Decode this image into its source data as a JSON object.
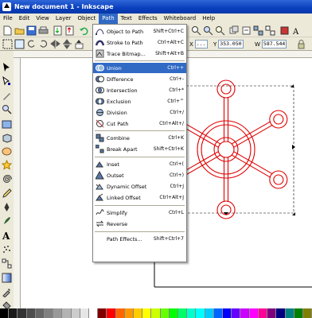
{
  "window": {
    "title": "New document 1 - Inkscape"
  },
  "menubar": [
    "File",
    "Edit",
    "View",
    "Layer",
    "Object",
    "Path",
    "Text",
    "Effects",
    "Whiteboard",
    "Help"
  ],
  "toolbar2": {
    "x_label": "X",
    "x_value": "...",
    "y_label": "Y",
    "y_value": "353.050",
    "w_label": "W",
    "w_value": "587.544"
  },
  "path_menu": [
    {
      "label": "Object to Path",
      "shortcut": "Shift+Ctrl+C",
      "icon": "object-to-path-icon"
    },
    {
      "label": "Stroke to Path",
      "shortcut": "Ctrl+Alt+C",
      "icon": "stroke-to-path-icon"
    },
    {
      "label": "Trace Bitmap...",
      "shortcut": "Shift+Alt+B",
      "icon": "trace-bitmap-icon"
    },
    {
      "label": "Union",
      "shortcut": "Ctrl++",
      "icon": "union-icon"
    },
    {
      "label": "Difference",
      "shortcut": "Ctrl+-",
      "icon": "difference-icon"
    },
    {
      "label": "Intersection",
      "shortcut": "Ctrl+*",
      "icon": "intersection-icon"
    },
    {
      "label": "Exclusion",
      "shortcut": "Ctrl+^",
      "icon": "exclusion-icon"
    },
    {
      "label": "Division",
      "shortcut": "Ctrl+/",
      "icon": "division-icon"
    },
    {
      "label": "Cut Path",
      "shortcut": "Ctrl+Alt+/",
      "icon": "cut-path-icon"
    },
    {
      "label": "Combine",
      "shortcut": "Ctrl+K",
      "icon": "combine-icon"
    },
    {
      "label": "Break Apart",
      "shortcut": "Shift+Ctrl+K",
      "icon": "break-apart-icon"
    },
    {
      "label": "Inset",
      "shortcut": "Ctrl+(",
      "icon": "inset-icon"
    },
    {
      "label": "Outset",
      "shortcut": "Ctrl+)",
      "icon": "outset-icon"
    },
    {
      "label": "Dynamic Offset",
      "shortcut": "Ctrl+J",
      "icon": "dynamic-offset-icon"
    },
    {
      "label": "Linked Offset",
      "shortcut": "Ctrl+Alt+J",
      "icon": "linked-offset-icon"
    },
    {
      "label": "Simplify",
      "shortcut": "Ctrl+L",
      "icon": "simplify-icon"
    },
    {
      "label": "Reverse",
      "shortcut": "",
      "icon": "reverse-icon"
    },
    {
      "label": "Path Effects...",
      "shortcut": "Shift+Ctrl+7",
      "icon": ""
    }
  ],
  "colors": {
    "selection": "#316ac5",
    "shape_stroke": "#e00000",
    "titlebar": "#0a3fbd"
  },
  "palette": [
    "#000000",
    "#1a1a1a",
    "#333333",
    "#4d4d4d",
    "#666666",
    "#808080",
    "#999999",
    "#b3b3b3",
    "#cccccc",
    "#e6e6e6",
    "#ffffff",
    "#800000",
    "#ff0000",
    "#ff6600",
    "#ff9900",
    "#ffcc00",
    "#ffff00",
    "#ccff00",
    "#66ff00",
    "#00ff00",
    "#00ff66",
    "#00ffcc",
    "#00ffff",
    "#00ccff",
    "#0066ff",
    "#0000ff",
    "#6600ff",
    "#cc00ff",
    "#ff00ff",
    "#ff0099",
    "#800080",
    "#000080",
    "#008080",
    "#008000",
    "#808000"
  ]
}
